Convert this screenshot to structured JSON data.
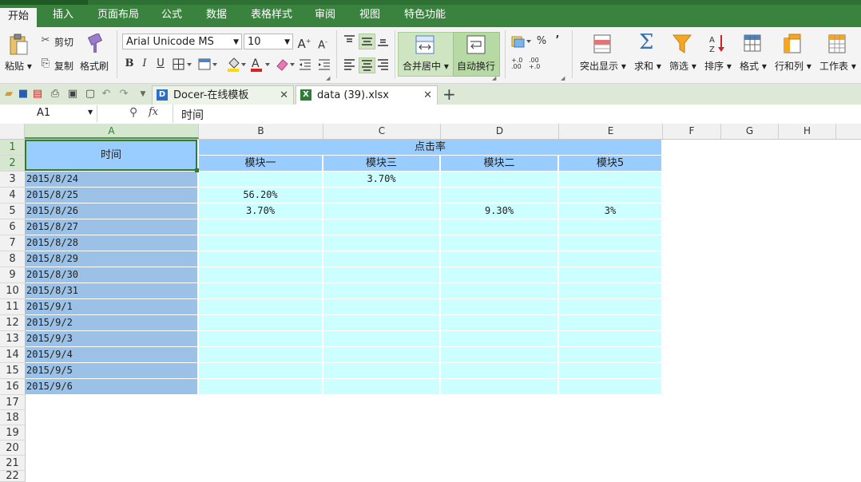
{
  "menu": [
    "开始",
    "插入",
    "页面布局",
    "公式",
    "数据",
    "表格样式",
    "审阅",
    "视图",
    "特色功能"
  ],
  "ribbon": {
    "paste": "粘贴",
    "cut": "剪切",
    "copy": "复制",
    "format_painter": "格式刷",
    "font_name": "Arial Unicode MS",
    "font_size": "10",
    "bold": "B",
    "italic": "I",
    "underline": "U",
    "merge_center": "合并居中",
    "wrap_text": "自动换行",
    "percent": "%",
    "comma": "’",
    "decimal_inc": "+.0 .00",
    "decimal_dec": ".00 +.0",
    "highlight": "突出显示",
    "sum": "求和",
    "filter": "筛选",
    "sort": "排序",
    "format": "格式",
    "rows_cols": "行和列",
    "worksheet": "工作表"
  },
  "tabs": [
    {
      "label": "Docer-在线模板"
    },
    {
      "label": "data (39).xlsx"
    }
  ],
  "name_box": "A1",
  "fx": "fx",
  "formula_value": "时间",
  "columns": [
    "A",
    "B",
    "C",
    "D",
    "E",
    "F",
    "G",
    "H"
  ],
  "rows": [
    "1",
    "2",
    "3",
    "4",
    "5",
    "6",
    "7",
    "8",
    "9",
    "10",
    "11",
    "12",
    "13",
    "14",
    "15",
    "16",
    "17",
    "18",
    "19",
    "20",
    "21",
    "22"
  ],
  "sheet": {
    "header_time": "时间",
    "header_click": "点击率",
    "subheaders": [
      "模块一",
      "模块三",
      "模块二",
      "模块5"
    ],
    "data_rows": [
      {
        "date": "2015/8/24",
        "b": "",
        "c": "3.70%",
        "d": "",
        "e": ""
      },
      {
        "date": "2015/8/25",
        "b": "56.20%",
        "c": "",
        "d": "",
        "e": ""
      },
      {
        "date": "2015/8/26",
        "b": "3.70%",
        "c": "",
        "d": "9.30%",
        "e": "3%"
      },
      {
        "date": "2015/8/27",
        "b": "",
        "c": "",
        "d": "",
        "e": ""
      },
      {
        "date": "2015/8/28",
        "b": "",
        "c": "",
        "d": "",
        "e": ""
      },
      {
        "date": "2015/8/29",
        "b": "",
        "c": "",
        "d": "",
        "e": ""
      },
      {
        "date": "2015/8/30",
        "b": "",
        "c": "",
        "d": "",
        "e": ""
      },
      {
        "date": "2015/8/31",
        "b": "",
        "c": "",
        "d": "",
        "e": ""
      },
      {
        "date": "2015/9/1",
        "b": "",
        "c": "",
        "d": "",
        "e": ""
      },
      {
        "date": "2015/9/2",
        "b": "",
        "c": "",
        "d": "",
        "e": ""
      },
      {
        "date": "2015/9/3",
        "b": "",
        "c": "",
        "d": "",
        "e": ""
      },
      {
        "date": "2015/9/4",
        "b": "",
        "c": "",
        "d": "",
        "e": ""
      },
      {
        "date": "2015/9/5",
        "b": "",
        "c": "",
        "d": "",
        "e": ""
      },
      {
        "date": "2015/9/6",
        "b": "",
        "c": "",
        "d": "",
        "e": ""
      }
    ]
  },
  "colors": {
    "menu_green": "#39833f",
    "header_blue": "#99ccff",
    "date_blue": "#9bc2e6",
    "data_cyan": "#ccffff",
    "selection_green": "#2e7d32"
  }
}
